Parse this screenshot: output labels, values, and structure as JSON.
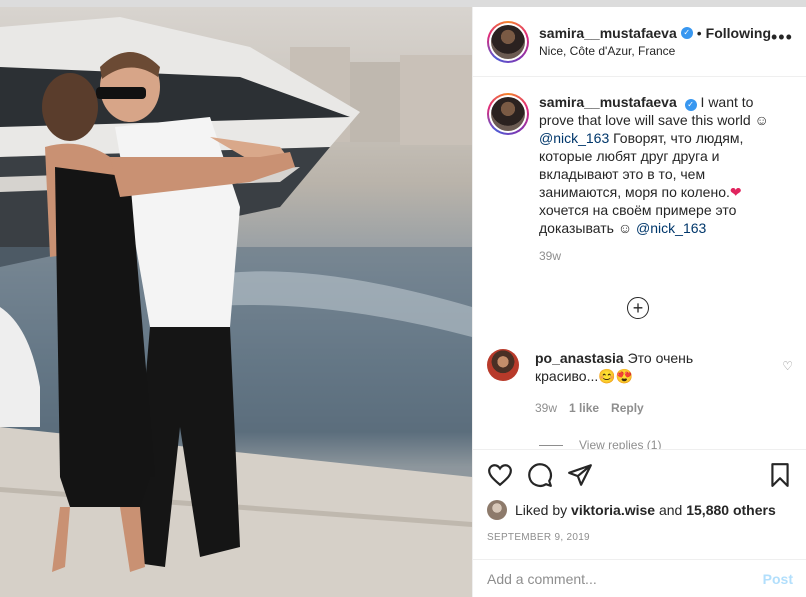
{
  "post": {
    "author": {
      "username": "samira__mustafaeva",
      "verified_icon": "verified-badge-icon",
      "follow_label": "Following",
      "location": "Nice, Côte d'Azur, France"
    },
    "more_icon": "more-options-icon",
    "caption": {
      "username": "samira__mustafaeva",
      "text_1": "I want to prove that love will save this world ☺",
      "mention_1": "@nick_163",
      "text_2": "Говорят, что людям, которые любят друг друга и вкладывают это в то, чем занимаются, моря по колено.",
      "heart": "❤",
      "text_3": "хочется на своём примере это доказывать ☺",
      "mention_2": "@nick_163",
      "age": "39w"
    },
    "load_more_icon": "plus-circle-icon",
    "comments": [
      {
        "username": "po_anastasia",
        "text": "Это очень красиво...😊😍",
        "age": "39w",
        "likes": "1 like",
        "reply_label": "Reply",
        "view_replies": "View replies (1)"
      }
    ],
    "actions": {
      "like_icon": "heart-icon",
      "comment_icon": "comment-icon",
      "share_icon": "share-icon",
      "save_icon": "bookmark-icon"
    },
    "likes": {
      "prefix": "Liked by",
      "user": "viktoria.wise",
      "and": "and",
      "others": "15,880 others"
    },
    "date": "SEPTEMBER 9, 2019",
    "add_comment": {
      "placeholder": "Add a comment...",
      "post_label": "Post"
    }
  },
  "colors": {
    "link": "#00376b",
    "verified": "#3897f0",
    "muted": "#8e8e8e",
    "post_disabled": "#b2dffc"
  }
}
